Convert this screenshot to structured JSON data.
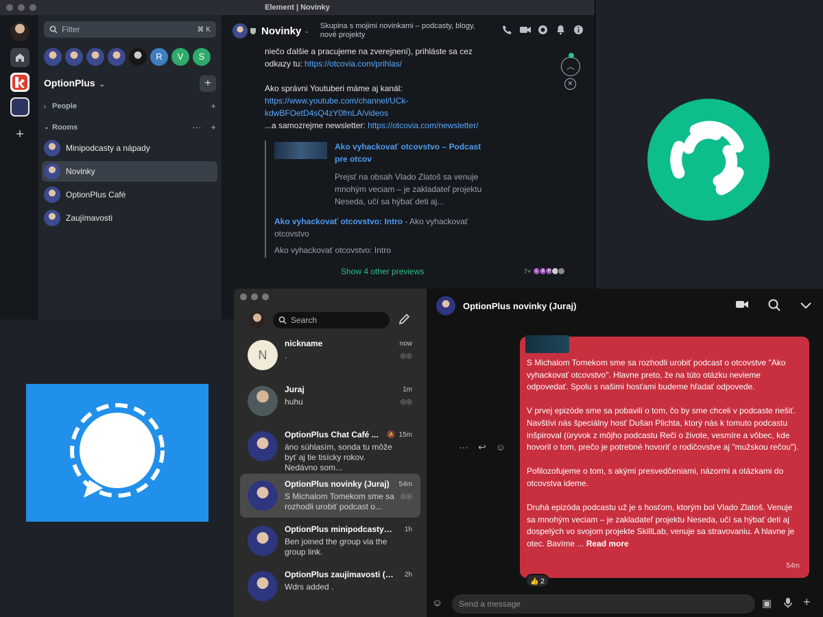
{
  "element": {
    "window_title": "Element | Novinky",
    "filter": {
      "placeholder": "Filter",
      "shortcut": "⌘ K"
    },
    "member_letters": [
      "R",
      "V",
      "S"
    ],
    "member_letter_colors": [
      "#3f7fbf",
      "#2eaa6b",
      "#2eaa6b"
    ],
    "space_name": "OptionPlus",
    "sections": {
      "people": "People",
      "rooms": "Rooms"
    },
    "rooms": [
      "Minipodcasty a nápady",
      "Novinky",
      "OptionPlus Café",
      "Zaujímavosti"
    ],
    "room": {
      "name": "Novinky",
      "topic": "Skupina s mojimi novinkami – podcasty, blogy, nové projekty"
    },
    "message": {
      "line1": "niečo ďalšie a pracujeme na zverejnení), prihláste sa cez",
      "line2_text": "odkazy tu: ",
      "line2_link": "https://otcovia.com/prihlas/",
      "line3": "Ako správni Youtuberi máme aj kanál:",
      "yt_link_1": "https://www.youtube.com/channel/UCk-",
      "yt_link_2": "kdwBFOetD4sQ4zY0fmLA/videos",
      "line5_text": "...a samozrejme newsletter: ",
      "line5_link": "https://otcovia.com/newsletter/"
    },
    "preview1": {
      "title": "Ako vyhackovať otcovstvo – Podcast pre otcov",
      "desc": "Prejsť na obsah Vlado Zlatoš sa venuje mnohým veciam – je zakladateľ projektu Neseda, učí sa hýbať deti aj..."
    },
    "preview2": {
      "title": "Ako vyhackovať otcovstvo: Intro",
      "sep": " - ",
      "site": "Ako vyhackovať otcovstvo",
      "desc": "Ako vyhackovať otcovstvo: Intro"
    },
    "show_more": "Show 4 other previews",
    "read_receipts": {
      "count": "7+",
      "letters": [
        "L",
        "A",
        "P"
      ]
    },
    "accent": "#2fbf86",
    "link_color": "#5aa9ff"
  },
  "signal": {
    "search_placeholder": "Search",
    "conversations": [
      {
        "name": "nickname",
        "time": "now",
        "preview": ".",
        "avatar_letter": "N"
      },
      {
        "name": "Juraj",
        "time": "1m",
        "preview": "huhu"
      },
      {
        "name": "OptionPlus Chat Café ...",
        "time": "15m",
        "preview": "áno súhlasím, sonda tu môže byť aj tie tisícky rokov. Nedávno som..."
      },
      {
        "name": "OptionPlus novinky (Juraj)",
        "time": "54m",
        "preview": "S Michalom Tomekom sme sa rozhodli urobiť podcast o..."
      },
      {
        "name": "OptionPlus minipodcasty (...",
        "time": "1h",
        "preview": "Ben joined the group via the group link."
      },
      {
        "name": "OptionPlus zaujímavosti (J...",
        "time": "2h",
        "preview": "Wdrs added ."
      }
    ],
    "chat_title": "OptionPlus novinky (Juraj)",
    "bubble_paragraphs": [
      "S Michalom Tomekom sme sa rozhodli urobiť podcast o otcovstve \"Ako vyhackovať otcovstvo\". Hlavne preto, že na túto otázku nevieme odpovedať. Spolu s našimi hosťami budeme hľadať odpovede.",
      "V prvej epizóde sme sa pobavili o tom, čo by sme chceli v podcaste riešiť. Navštívi nás špeciálny hosť Dušan Plichta, ktorý nás k tomuto podcastu inšpiroval (úryvok z môjho podcastu Reči o živote, vesmíre a vôbec, kde hovoril o tom, prečo je potrebné hovoriť o rodičovstve aj \"mužskou rečou\").",
      "Pofilozofujeme o tom, s akými presvedčeniami, názormi a otázkami do otcovstva ideme."
    ],
    "bubble_last": "Druhá epizóda podcastu už je s hosťom, ktorým bol Vlado Zlatoš. Venuje sa mnohým veciam – je zakladateľ projektu Neseda, učí sa hýbať deti aj dospelých vo svojom projekte SkillLab, venuje sa stravovaniu. A hlavne je otec.  Bavíme ... ",
    "read_more": "Read more",
    "bubble_time": "54m",
    "reaction": "👍 2",
    "compose_placeholder": "Send a message",
    "bubble_color": "#c8303f"
  },
  "logos": {
    "element_color": "#0dbd8b",
    "signal_color": "#2190ea"
  }
}
